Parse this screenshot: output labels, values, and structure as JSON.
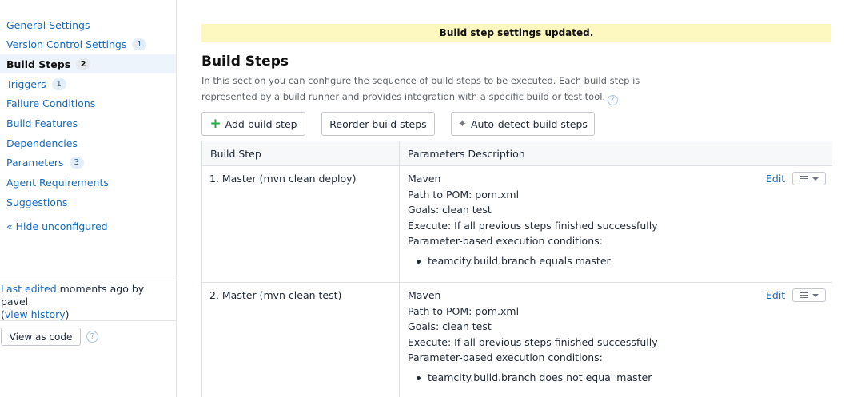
{
  "sidebar": {
    "items": [
      {
        "label": "General Settings",
        "badge": ""
      },
      {
        "label": "Version Control Settings",
        "badge": "1"
      },
      {
        "label": "Build Steps",
        "badge": "2"
      },
      {
        "label": "Triggers",
        "badge": "1"
      },
      {
        "label": "Failure Conditions",
        "badge": ""
      },
      {
        "label": "Build Features",
        "badge": ""
      },
      {
        "label": "Dependencies",
        "badge": ""
      },
      {
        "label": "Parameters",
        "badge": "3"
      },
      {
        "label": "Agent Requirements",
        "badge": ""
      },
      {
        "label": "Suggestions",
        "badge": ""
      }
    ],
    "active_item": "Build Steps",
    "hide_unconfigured": "« Hide unconfigured",
    "last_edited": {
      "link": "Last edited",
      "text": " moments ago by pavel",
      "history_open": "(",
      "history_link": "view history",
      "history_close": ")"
    },
    "view_as_code": "View as code"
  },
  "banner": "Build step settings updated.",
  "page": {
    "title": "Build Steps",
    "description": "In this section you can configure the sequence of build steps to be executed. Each build step is represented by a build runner and provides integration with a specific build or test tool.",
    "help_glyph": "?"
  },
  "toolbar": {
    "add_plus": "+",
    "add_label": "Add build step",
    "reorder_label": "Reorder build steps",
    "autodetect_label": "Auto-detect build steps"
  },
  "table": {
    "headers": [
      "Build Step",
      "Parameters Description"
    ],
    "rows": [
      {
        "step": "1. Master (mvn clean deploy)",
        "runner": "Maven",
        "pom": "Path to POM: pom.xml",
        "goals": "Goals: clean test",
        "execute": "Execute: If all previous steps finished successfully",
        "conditions_title": "Parameter-based execution conditions:",
        "condition": "teamcity.build.branch equals master",
        "edit": "Edit"
      },
      {
        "step": "2. Master (mvn clean test)",
        "runner": "Maven",
        "pom": "Path to POM: pom.xml",
        "goals": "Goals: clean test",
        "execute": "Execute: If all previous steps finished successfully",
        "conditions_title": "Parameter-based execution conditions:",
        "condition": "teamcity.build.branch does not equal master",
        "edit": "Edit"
      }
    ]
  },
  "icons": {
    "help": "help-circle-icon",
    "plus": "plus-icon",
    "wand": "magic-wand-icon",
    "row_menu": "list-dropdown-icon"
  },
  "colors": {
    "link": "#1b6ab8",
    "banner_bg": "#fdf8bf",
    "add_icon": "#2ba84a",
    "active_nav_bg": "#eef4fb"
  }
}
